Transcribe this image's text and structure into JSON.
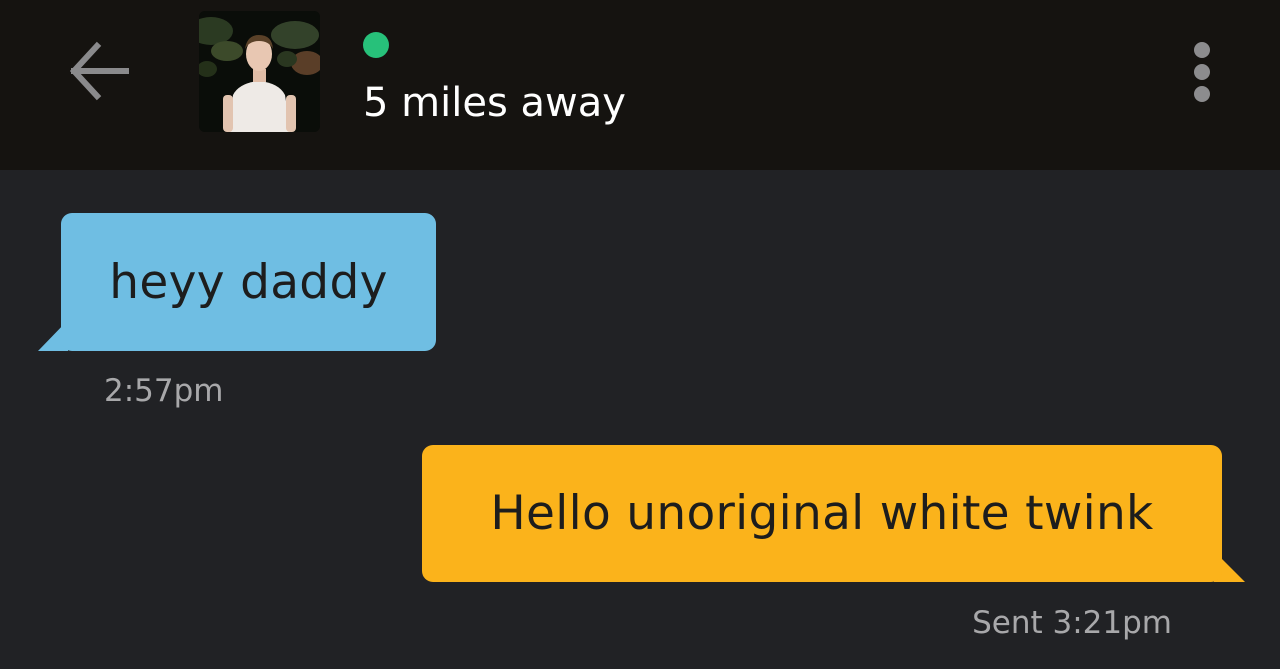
{
  "header": {
    "distance": "5 miles away",
    "online_color": "#27c17a"
  },
  "icons": {
    "back": "back-arrow-icon",
    "menu": "more-vertical-icon"
  },
  "messages": [
    {
      "direction": "received",
      "text": "heyy daddy",
      "time": "2:57pm",
      "bubble_color": "#6fbee3"
    },
    {
      "direction": "sent",
      "text": "Hello unoriginal white twink",
      "time": "Sent 3:21pm",
      "bubble_color": "#fbb31b"
    }
  ],
  "colors": {
    "header_bg": "#151310",
    "chat_bg": "#212225",
    "timestamp": "#a8a8aa"
  }
}
